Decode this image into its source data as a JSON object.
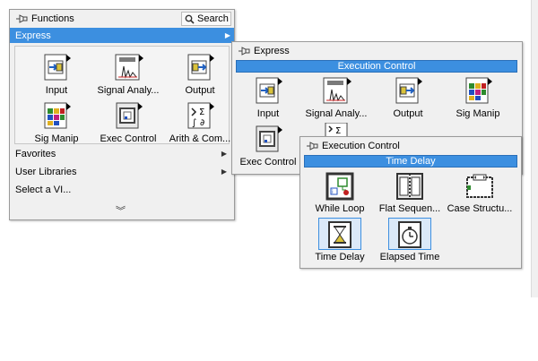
{
  "functions": {
    "title": "Functions",
    "search_label": "Search",
    "selected_category": "Express",
    "icons": [
      {
        "label": "Input"
      },
      {
        "label": "Signal Analy..."
      },
      {
        "label": "Output"
      },
      {
        "label": "Sig Manip"
      },
      {
        "label": "Exec Control"
      },
      {
        "label": "Arith & Com..."
      }
    ],
    "menu": [
      "Favorites",
      "User Libraries",
      "Select a VI..."
    ],
    "more_icon": "double-chevron-down-icon"
  },
  "express": {
    "title": "Express",
    "header": "Execution Control",
    "icons": [
      {
        "label": "Input"
      },
      {
        "label": "Signal Analy..."
      },
      {
        "label": "Output"
      },
      {
        "label": "Sig Manip"
      },
      {
        "label": "Exec Control"
      }
    ]
  },
  "execution_control": {
    "title": "Execution Control",
    "header": "Time Delay",
    "icons": [
      {
        "label": "While Loop"
      },
      {
        "label": "Flat Sequen..."
      },
      {
        "label": "Case Structu..."
      },
      {
        "label": "Time Delay",
        "selected": true
      },
      {
        "label": "Elapsed Time",
        "selected": true
      }
    ]
  },
  "colors": {
    "accent": "#3c8fe0",
    "panel": "#f0f0f0",
    "border": "#9a9a9a"
  }
}
